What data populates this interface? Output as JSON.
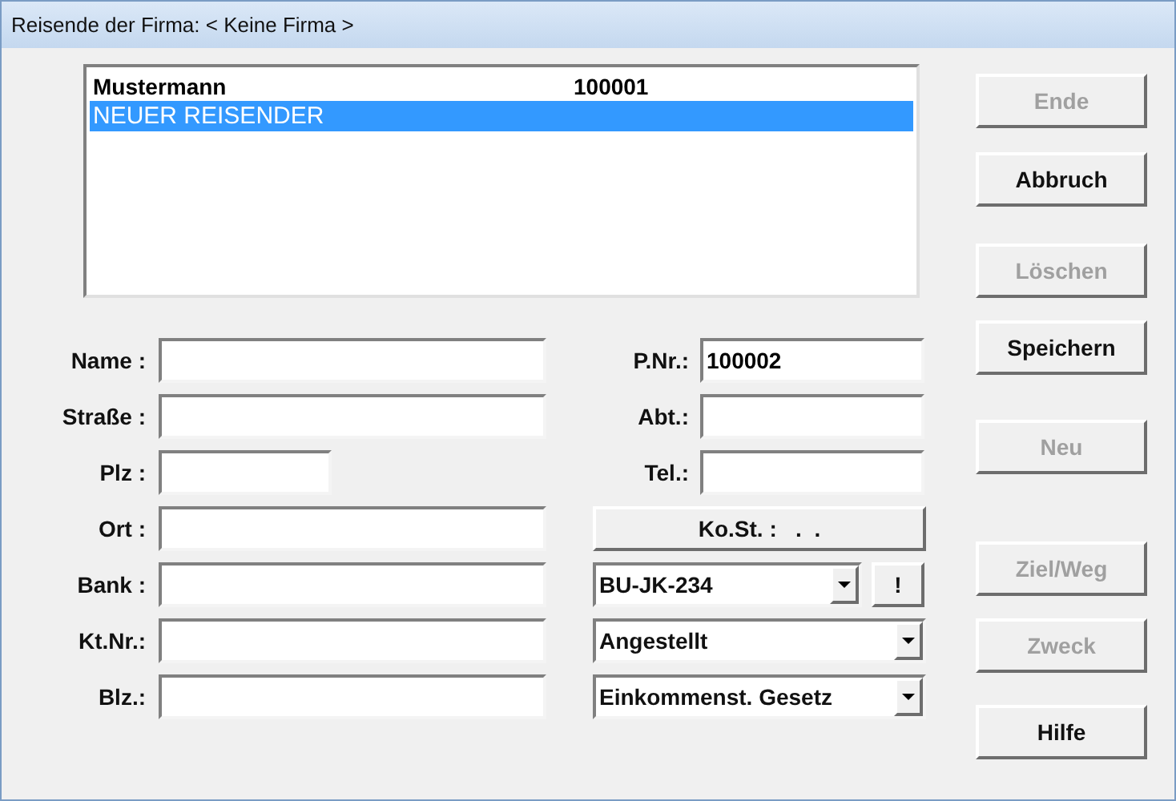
{
  "window": {
    "title": "Reisende der Firma: < Keine Firma >"
  },
  "list": {
    "rows": [
      {
        "name": "Mustermann",
        "number": "100001",
        "selected": false
      },
      {
        "name": "NEUER REISENDER",
        "selected": true
      }
    ]
  },
  "fields_left": [
    {
      "label": "Name :",
      "kind": "wide"
    },
    {
      "label": "Straße :",
      "kind": "wide"
    },
    {
      "label": "Plz :",
      "kind": "short"
    },
    {
      "label": "Ort :",
      "kind": "wide"
    },
    {
      "label": "Bank :",
      "kind": "wide"
    },
    {
      "label": "Kt.Nr.:",
      "kind": "wide"
    },
    {
      "label": "Blz.:",
      "kind": "wide"
    }
  ],
  "fields_right": [
    {
      "label": "P.Nr.:",
      "value": "100002"
    },
    {
      "label": "Abt.:"
    },
    {
      "label": "Tel.:"
    }
  ],
  "kost_button": {
    "label": "Ko.St. :   .  ."
  },
  "combos": [
    {
      "value": "BU-JK-234",
      "extra_button": "!"
    },
    {
      "value": "Angestellt"
    },
    {
      "value": "Einkommenst. Gesetz"
    }
  ],
  "buttons": [
    {
      "label": "Ende",
      "disabled": true
    },
    {
      "label": "Abbruch",
      "disabled": false
    },
    {
      "label": "Löschen",
      "disabled": true
    },
    {
      "label": "Speichern",
      "disabled": false
    },
    {
      "label": "Neu",
      "disabled": true
    },
    {
      "label": "Ziel/Weg",
      "disabled": true
    },
    {
      "label": "Zweck",
      "disabled": true
    },
    {
      "label": "Hilfe",
      "disabled": false
    }
  ]
}
